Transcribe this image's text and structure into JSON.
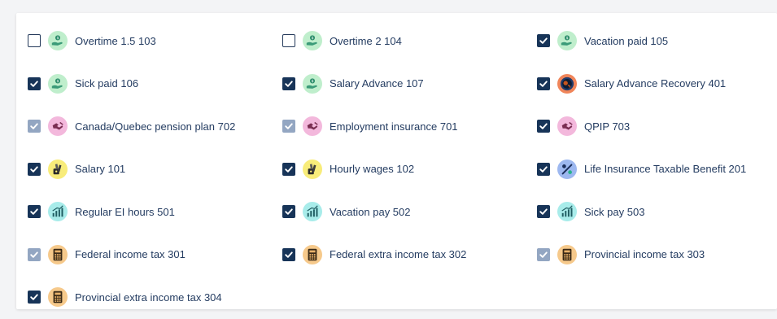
{
  "items": [
    {
      "label": "Overtime 1.5 103",
      "state": "unchecked",
      "icon": "money-hand-icon",
      "icon_bg": "#bfeecc"
    },
    {
      "label": "Overtime 2 104",
      "state": "unchecked",
      "icon": "money-hand-icon",
      "icon_bg": "#bfeecc"
    },
    {
      "label": "Vacation paid 105",
      "state": "checked",
      "icon": "money-hand-icon",
      "icon_bg": "#bfeecc"
    },
    {
      "label": "Sick paid 106",
      "state": "checked",
      "icon": "money-hand-icon",
      "icon_bg": "#bfeecc"
    },
    {
      "label": "Salary Advance 107",
      "state": "checked",
      "icon": "money-hand-icon",
      "icon_bg": "#bfeecc"
    },
    {
      "label": "Salary Advance Recovery 401",
      "state": "checked",
      "icon": "coin-return-icon",
      "icon_bg": "#f0855a"
    },
    {
      "label": "Canada/Quebec pension plan 702",
      "state": "disabled",
      "icon": "handshake-icon",
      "icon_bg": "#f3b8dc"
    },
    {
      "label": "Employment insurance 701",
      "state": "disabled",
      "icon": "handshake-icon",
      "icon_bg": "#f3b8dc"
    },
    {
      "label": "QPIP 703",
      "state": "checked",
      "icon": "handshake-icon",
      "icon_bg": "#f3b8dc"
    },
    {
      "label": "Salary 101",
      "state": "checked",
      "icon": "money-bag-icon",
      "icon_bg": "#f8ec7a"
    },
    {
      "label": "Hourly wages 102",
      "state": "checked",
      "icon": "money-bag-icon",
      "icon_bg": "#f8ec7a"
    },
    {
      "label": "Life Insurance Taxable Benefit 201",
      "state": "checked",
      "icon": "percent-icon",
      "icon_bg": "#9db8f0"
    },
    {
      "label": "Regular EI hours 501",
      "state": "checked",
      "icon": "bar-chart-icon",
      "icon_bg": "#a8ecea"
    },
    {
      "label": "Vacation pay 502",
      "state": "checked",
      "icon": "bar-chart-icon",
      "icon_bg": "#a8ecea"
    },
    {
      "label": "Sick pay 503",
      "state": "checked",
      "icon": "bar-chart-icon",
      "icon_bg": "#a8ecea"
    },
    {
      "label": "Federal income tax 301",
      "state": "disabled",
      "icon": "calculator-icon",
      "icon_bg": "#f6c98b"
    },
    {
      "label": "Federal extra income tax 302",
      "state": "checked",
      "icon": "calculator-icon",
      "icon_bg": "#f6c98b"
    },
    {
      "label": "Provincial income tax 303",
      "state": "disabled",
      "icon": "calculator-icon",
      "icon_bg": "#f6c98b"
    },
    {
      "label": "Provincial extra income tax 304",
      "state": "checked",
      "icon": "calculator-icon",
      "icon_bg": "#f6c98b"
    }
  ],
  "colors": {
    "checked": "#173458",
    "disabled": "#93a6c2",
    "text": "#243c61"
  }
}
